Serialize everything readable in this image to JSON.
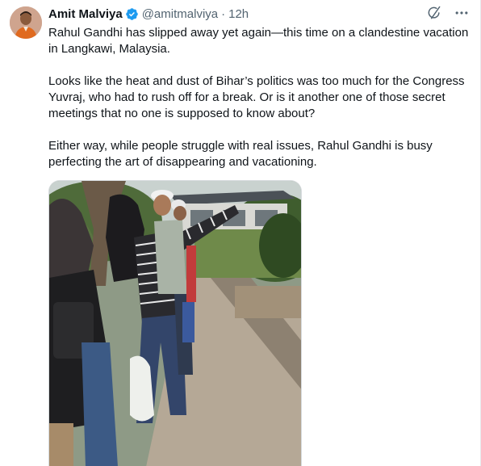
{
  "author": {
    "name": "Amit Malviya",
    "handle": "@amitmalviya",
    "separator": "·",
    "time": "12h",
    "verified": true,
    "verified_color": "#1d9bf0"
  },
  "icons": {
    "avatar": "profile-photo",
    "verified": "verified-badge-icon",
    "grok": "grok-icon",
    "more": "more-options-icon"
  },
  "tweet": {
    "paragraphs": [
      "Rahul Gandhi has slipped away yet again—this time on a clandestine vacation in Langkawi, Malaysia.",
      "Looks like the heat and dust of Bihar’s politics was too much for the Congress Yuvraj, who had to rush off for a break. Or is it another one of those secret meetings that no one is supposed to know about?",
      "Either way, while people struggle with real issues, Rahul Gandhi is busy perfecting the art of disappearing and vacationing."
    ]
  },
  "media": {
    "type": "photo"
  }
}
